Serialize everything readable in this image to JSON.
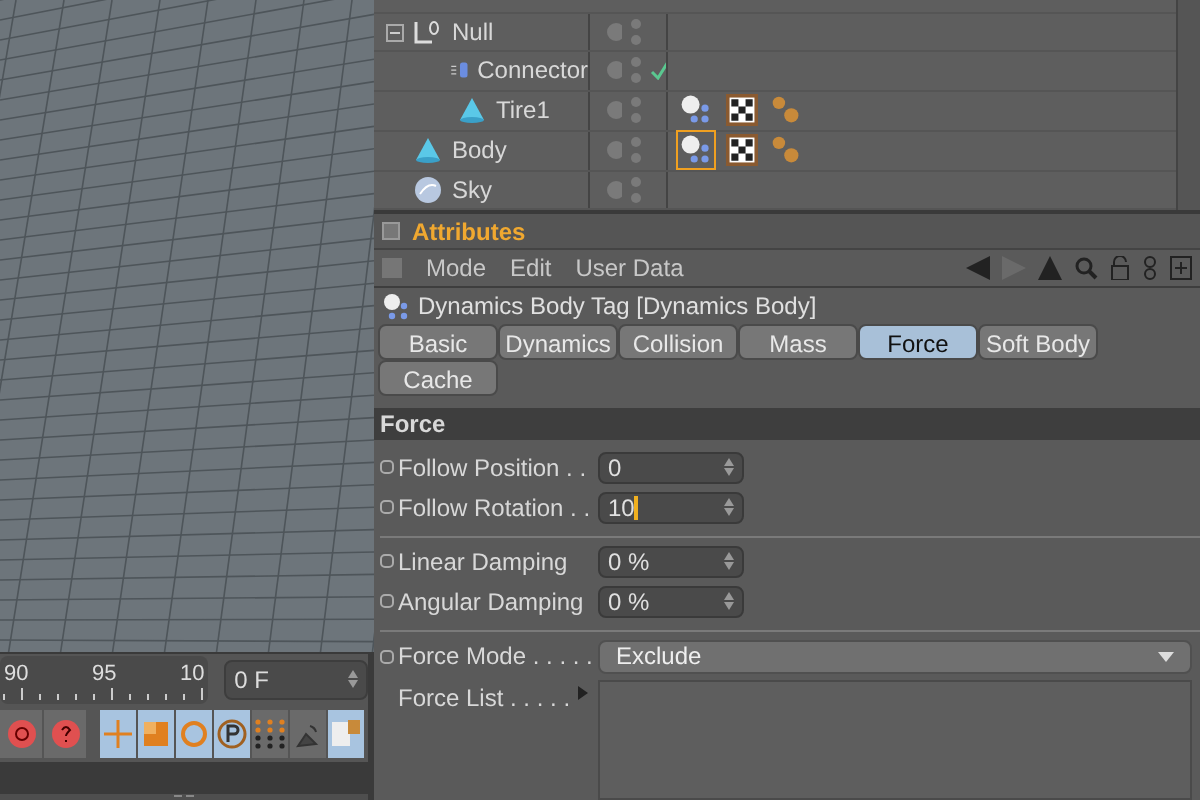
{
  "objects": [
    {
      "name": "Null",
      "kind": "null",
      "expanded": true,
      "children": [
        {
          "name": "Connector",
          "kind": "connector",
          "check": true
        },
        {
          "name": "Tire1",
          "kind": "cone",
          "tags": [
            {
              "kind": "dynamics",
              "selected": false
            },
            {
              "kind": "texture",
              "selected": false
            },
            {
              "kind": "material",
              "selected": false
            }
          ]
        }
      ]
    },
    {
      "name": "Body",
      "kind": "cone",
      "tags": [
        {
          "kind": "dynamics",
          "selected": true
        },
        {
          "kind": "texture",
          "selected": false
        },
        {
          "kind": "material",
          "selected": false
        }
      ]
    },
    {
      "name": "Sky",
      "kind": "sky"
    }
  ],
  "attributes": {
    "title": "Attributes",
    "menu": [
      "Mode",
      "Edit",
      "User Data"
    ],
    "object_title": "Dynamics Body Tag [Dynamics Body]",
    "tabs": [
      {
        "label": "Basic",
        "selected": false
      },
      {
        "label": "Dynamics",
        "selected": false
      },
      {
        "label": "Collision",
        "selected": false
      },
      {
        "label": "Mass",
        "selected": false
      },
      {
        "label": "Force",
        "selected": true
      },
      {
        "label": "Soft Body",
        "selected": false
      },
      {
        "label": "Cache",
        "selected": false
      }
    ],
    "section": "Force",
    "groups": [
      [
        {
          "kind": "number",
          "label": "Follow Position . .",
          "value": "0",
          "editing": false
        },
        {
          "kind": "number",
          "label": "Follow Rotation . .",
          "value": "10",
          "editing": true
        }
      ],
      [
        {
          "kind": "number",
          "label": "Linear Damping",
          "value": "0 %",
          "editing": false
        },
        {
          "kind": "number",
          "label": "Angular Damping",
          "value": "0 %",
          "editing": false
        }
      ],
      [
        {
          "kind": "dropdown",
          "label": "Force Mode . . . . .",
          "value": "Exclude"
        },
        {
          "kind": "list",
          "label": "Force List . . . . ."
        }
      ]
    ]
  },
  "timeline": {
    "ticks": [
      "90",
      "95",
      "10"
    ],
    "frame": "0 F"
  },
  "tools": [
    {
      "kind": "record",
      "selected": false
    },
    {
      "kind": "help",
      "selected": false
    },
    {
      "kind": "move",
      "selected": true
    },
    {
      "kind": "scale",
      "selected": true
    },
    {
      "kind": "rotate",
      "selected": true
    },
    {
      "kind": "param",
      "selected": true
    },
    {
      "kind": "points",
      "selected": false
    },
    {
      "kind": "dish",
      "selected": false
    },
    {
      "kind": "render",
      "selected": true
    }
  ]
}
